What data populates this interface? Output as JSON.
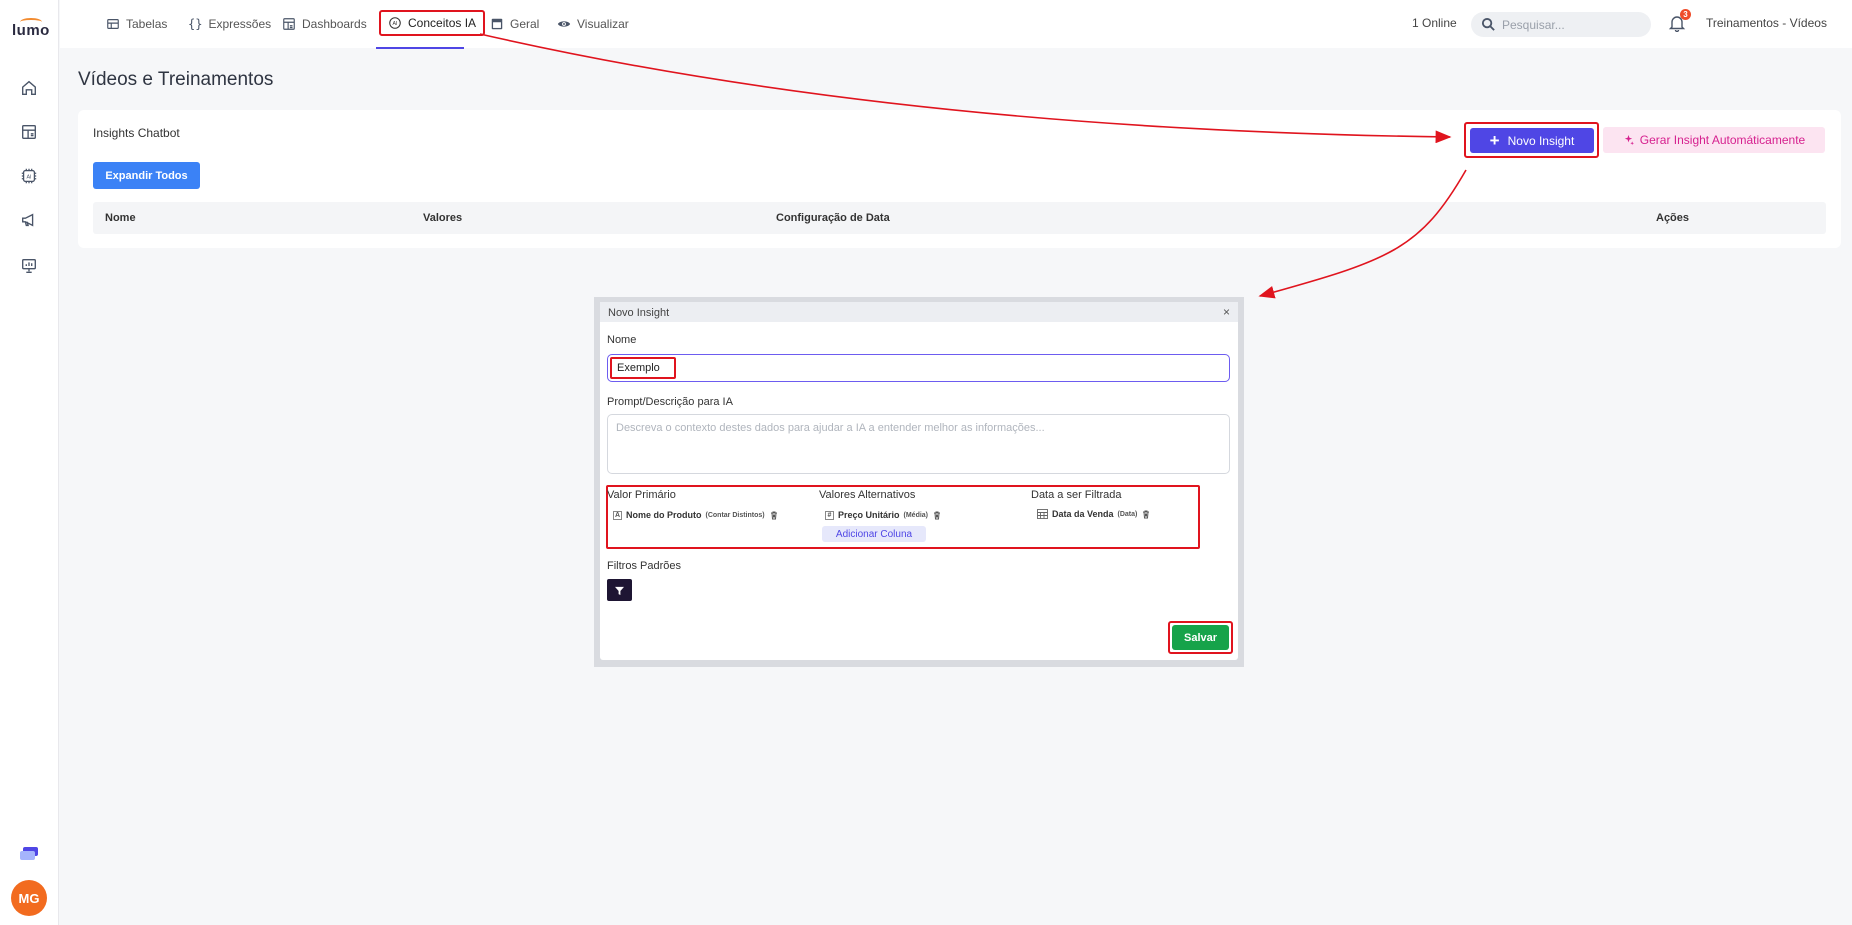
{
  "app": {
    "logo_text": "lumo",
    "user_initials": "MG"
  },
  "nav": {
    "tabs": [
      {
        "label": "Tabelas",
        "icon": "table-icon"
      },
      {
        "label": "Expressões",
        "icon": "braces-icon"
      },
      {
        "label": "Dashboards",
        "icon": "dashboard-icon"
      },
      {
        "label": "Conceitos IA",
        "icon": "ai-icon",
        "active": true
      },
      {
        "label": "Geral",
        "icon": "window-icon"
      },
      {
        "label": "Visualizar",
        "icon": "eye-icon"
      }
    ],
    "online": "1 Online",
    "search_placeholder": "Pesquisar...",
    "notification_count": "3",
    "workspace": "Treinamentos - Vídeos"
  },
  "page": {
    "title": "Vídeos e Treinamentos",
    "card_title": "Insights Chatbot",
    "expand_all": "Expandir Todos",
    "new_insight": "Novo Insight",
    "auto_insight": "Gerar Insight Automáticamente",
    "table_headers": [
      "Nome",
      "Valores",
      "Configuração de Data",
      "Ações"
    ]
  },
  "modal": {
    "title": "Novo Insight",
    "close": "×",
    "name_label": "Nome",
    "name_value": "Exemplo",
    "prompt_label": "Prompt/Descrição para IA",
    "prompt_placeholder": "Descreva o contexto destes dados para ajudar a IA a entender melhor as informações...",
    "primary_label": "Valor Primário",
    "alternatives_label": "Valores Alternativos",
    "date_label": "Data a ser Filtrada",
    "primary_chip": {
      "type": "A",
      "name": "Nome do Produto",
      "agg": "(Contar Distintos)"
    },
    "alt_chip": {
      "type": "#",
      "name": "Preço Unitário",
      "agg": "(Média)"
    },
    "date_chip": {
      "name": "Data da Venda",
      "agg": "(Data)"
    },
    "add_column": "Adicionar Coluna",
    "default_filters_label": "Filtros Padrões",
    "save": "Salvar"
  },
  "colors": {
    "accent": "#4f46e5",
    "highlight": "#e0141e",
    "save": "#16a34a",
    "expand": "#3b82f6",
    "auto_insight_bg": "#fce4f1",
    "auto_insight_text": "#d6218f"
  }
}
